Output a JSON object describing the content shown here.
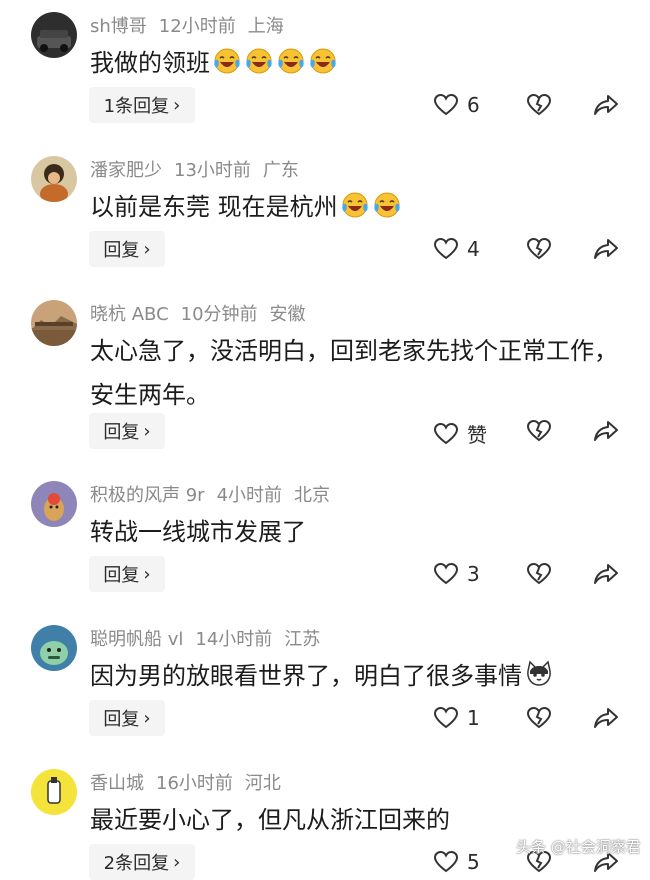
{
  "comments": [
    {
      "username": "sh博哥",
      "time": "12小时前",
      "location": "上海",
      "text": "我做的领班",
      "emojis": [
        "cry-laugh",
        "cry-laugh",
        "cry-laugh",
        "cry-laugh"
      ],
      "reply_label": "1条回复",
      "like_label": "6"
    },
    {
      "username": "潘家肥少",
      "time": "13小时前",
      "location": "广东",
      "text": "以前是东莞 现在是杭州",
      "emojis": [
        "cry-laugh",
        "cry-laugh"
      ],
      "reply_label": "回复",
      "like_label": "4"
    },
    {
      "username": "晓杭 ABC",
      "time": "10分钟前",
      "location": "安徽",
      "text": "太心急了，没活明白，回到老家先找个正常工作，安生两年。",
      "emojis": [],
      "reply_label": "回复",
      "like_label": "赞"
    },
    {
      "username": "积极的风声 9r",
      "time": "4小时前",
      "location": "北京",
      "text": "转战一线城市发展了",
      "emojis": [],
      "reply_label": "回复",
      "like_label": "3"
    },
    {
      "username": "聪明帆船 vl",
      "time": "14小时前",
      "location": "江苏",
      "text": "因为男的放眼看世界了，明白了很多事情",
      "emojis": [
        "cat-face"
      ],
      "reply_label": "回复",
      "like_label": "1"
    },
    {
      "username": "香山城",
      "time": "16小时前",
      "location": "河北",
      "text": "最近要小心了，但凡从浙江回来的",
      "emojis": [],
      "reply_label": "2条回复",
      "like_label": "5"
    }
  ],
  "icons": {
    "chevron": "chevron-right-icon",
    "like": "heart-outline-icon",
    "dislike": "broken-heart-icon",
    "share": "share-arrow-icon"
  },
  "watermark": "头条 @社会洞察君",
  "colors": {
    "meta": "#8a8a8a",
    "text": "#1c1c1c",
    "button_bg": "#f4f4f5"
  }
}
